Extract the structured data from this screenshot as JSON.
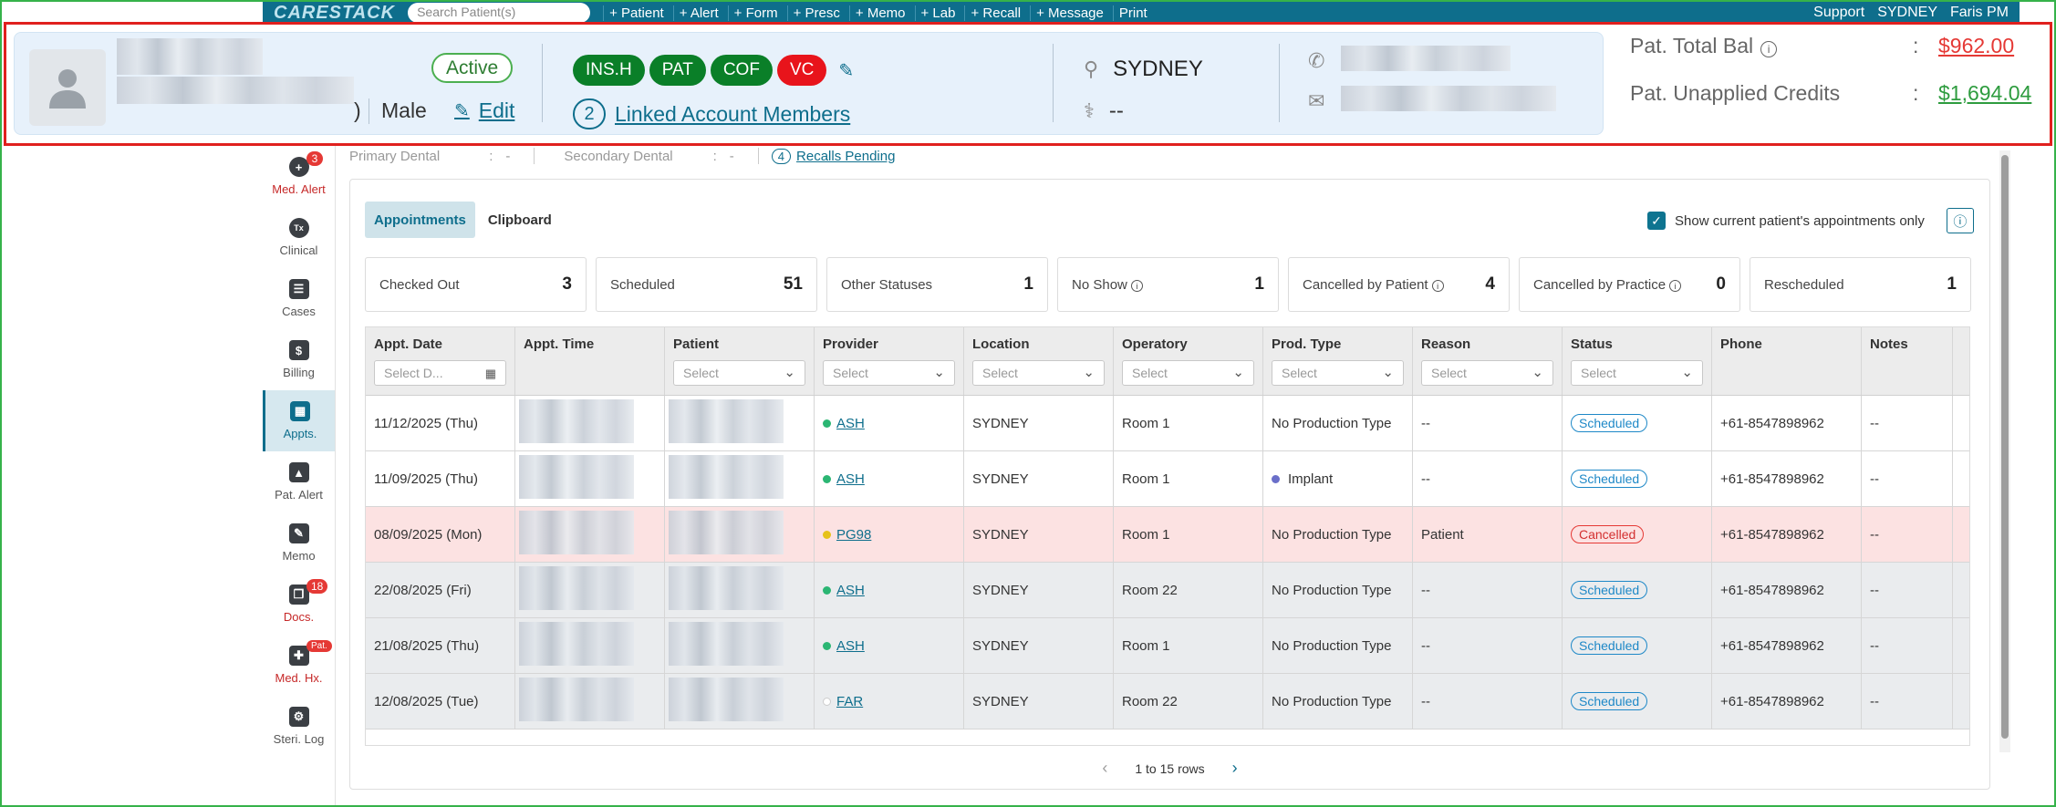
{
  "topbar": {
    "logo": "CARESTACK",
    "search_placeholder": "Search Patient(s)",
    "buttons": [
      "+ Patient",
      "+ Alert",
      "+ Form",
      "+ Presc",
      "+ Memo",
      "+ Lab",
      "+ Recall",
      "+ Message",
      "Print"
    ],
    "support": "Support",
    "location": "SYDNEY",
    "user": "Faris PM"
  },
  "patient": {
    "status": "Active",
    "gender": "Male",
    "edit_label": "Edit",
    "tags": [
      {
        "label": "INS.H",
        "color": "#0a7f28"
      },
      {
        "label": "PAT",
        "color": "#0a7f28"
      },
      {
        "label": "COF",
        "color": "#0a7f28"
      },
      {
        "label": "VC",
        "color": "#e8141b"
      }
    ],
    "linked_count": "2",
    "linked_label": "Linked Account Members",
    "location": "SYDNEY",
    "doctor": "--",
    "balance_label": "Pat. Total Bal",
    "balance_value": "$962.00",
    "balance_color": "#e53935",
    "credits_label": "Pat. Unapplied Credits",
    "credits_value": "$1,694.04",
    "credits_color": "#2e9c3f"
  },
  "insurance": {
    "primary_label": "Primary Dental",
    "primary_value": "-",
    "secondary_label": "Secondary Dental",
    "secondary_value": "-",
    "recalls_count": "4",
    "recalls_label": "Recalls Pending"
  },
  "sidebar": {
    "items": [
      {
        "label": "Med. Alert",
        "icon": "plus-circle-icon",
        "badge": "3",
        "red": true
      },
      {
        "label": "Clinical",
        "icon": "tx-icon",
        "badge": "",
        "red": false
      },
      {
        "label": "Cases",
        "icon": "clipboard-icon",
        "badge": "",
        "red": false
      },
      {
        "label": "Billing",
        "icon": "dollar-file-icon",
        "badge": "",
        "red": false
      },
      {
        "label": "Appts.",
        "icon": "calendar-icon",
        "badge": "",
        "red": false,
        "active": true
      },
      {
        "label": "Pat. Alert",
        "icon": "warning-icon",
        "badge": "",
        "red": false
      },
      {
        "label": "Memo",
        "icon": "memo-icon",
        "badge": "",
        "red": false
      },
      {
        "label": "Docs.",
        "icon": "docs-icon",
        "badge": "18",
        "red": true
      },
      {
        "label": "Med. Hx.",
        "icon": "med-history-icon",
        "badge": "Pat.",
        "red": true
      },
      {
        "label": "Steri. Log",
        "icon": "gear-icon",
        "badge": "",
        "red": false
      }
    ]
  },
  "appointments": {
    "tabs": [
      "Appointments",
      "Clipboard"
    ],
    "show_current_label": "Show current patient's appointments only",
    "stats": [
      {
        "label": "Checked Out",
        "value": "3",
        "info": false
      },
      {
        "label": "Scheduled",
        "value": "51",
        "info": false
      },
      {
        "label": "Other Statuses",
        "value": "1",
        "info": false
      },
      {
        "label": "No Show",
        "value": "1",
        "info": true
      },
      {
        "label": "Cancelled by Patient",
        "value": "4",
        "info": true
      },
      {
        "label": "Cancelled by Practice",
        "value": "0",
        "info": true
      },
      {
        "label": "Rescheduled",
        "value": "1",
        "info": false
      }
    ],
    "columns": [
      "Appt. Date",
      "Appt. Time",
      "Patient",
      "Provider",
      "Location",
      "Operatory",
      "Prod. Type",
      "Reason",
      "Status",
      "Phone",
      "Notes"
    ],
    "filters": {
      "date_placeholder": "Select D...",
      "select_placeholder": "Select"
    },
    "rows": [
      {
        "date": "11/12/2025 (Thu)",
        "provider": "ASH",
        "provider_color": "#2bb673",
        "location": "SYDNEY",
        "operatory": "Room 1",
        "prod_type": "No Production Type",
        "prod_dot": "",
        "reason": "--",
        "status": "Scheduled",
        "phone": "+61-8547898962",
        "notes": "--",
        "style": "white"
      },
      {
        "date": "11/09/2025 (Thu)",
        "provider": "ASH",
        "provider_color": "#2bb673",
        "location": "SYDNEY",
        "operatory": "Room 1",
        "prod_type": "Implant",
        "prod_dot": "#6a6fc9",
        "reason": "--",
        "status": "Scheduled",
        "phone": "+61-8547898962",
        "notes": "--",
        "style": "white"
      },
      {
        "date": "08/09/2025 (Mon)",
        "provider": "PG98",
        "provider_color": "#e6c21a",
        "location": "SYDNEY",
        "operatory": "Room 1",
        "prod_type": "No Production Type",
        "prod_dot": "",
        "reason": "Patient",
        "status": "Cancelled",
        "phone": "+61-8547898962",
        "notes": "--",
        "style": "cancelled"
      },
      {
        "date": "22/08/2025 (Fri)",
        "provider": "ASH",
        "provider_color": "#2bb673",
        "location": "SYDNEY",
        "operatory": "Room 22",
        "prod_type": "No Production Type",
        "prod_dot": "",
        "reason": "--",
        "status": "Scheduled",
        "phone": "+61-8547898962",
        "notes": "--",
        "style": "grey"
      },
      {
        "date": "21/08/2025 (Thu)",
        "provider": "ASH",
        "provider_color": "#2bb673",
        "location": "SYDNEY",
        "operatory": "Room 1",
        "prod_type": "No Production Type",
        "prod_dot": "",
        "reason": "--",
        "status": "Scheduled",
        "phone": "+61-8547898962",
        "notes": "--",
        "style": "grey"
      },
      {
        "date": "12/08/2025 (Tue)",
        "provider": "FAR",
        "provider_color": "#ffffff",
        "location": "SYDNEY",
        "operatory": "Room 22",
        "prod_type": "No Production Type",
        "prod_dot": "",
        "reason": "--",
        "status": "Scheduled",
        "phone": "+61-8547898962",
        "notes": "--",
        "style": "grey"
      }
    ],
    "pager_text": "1 to 15 rows"
  }
}
